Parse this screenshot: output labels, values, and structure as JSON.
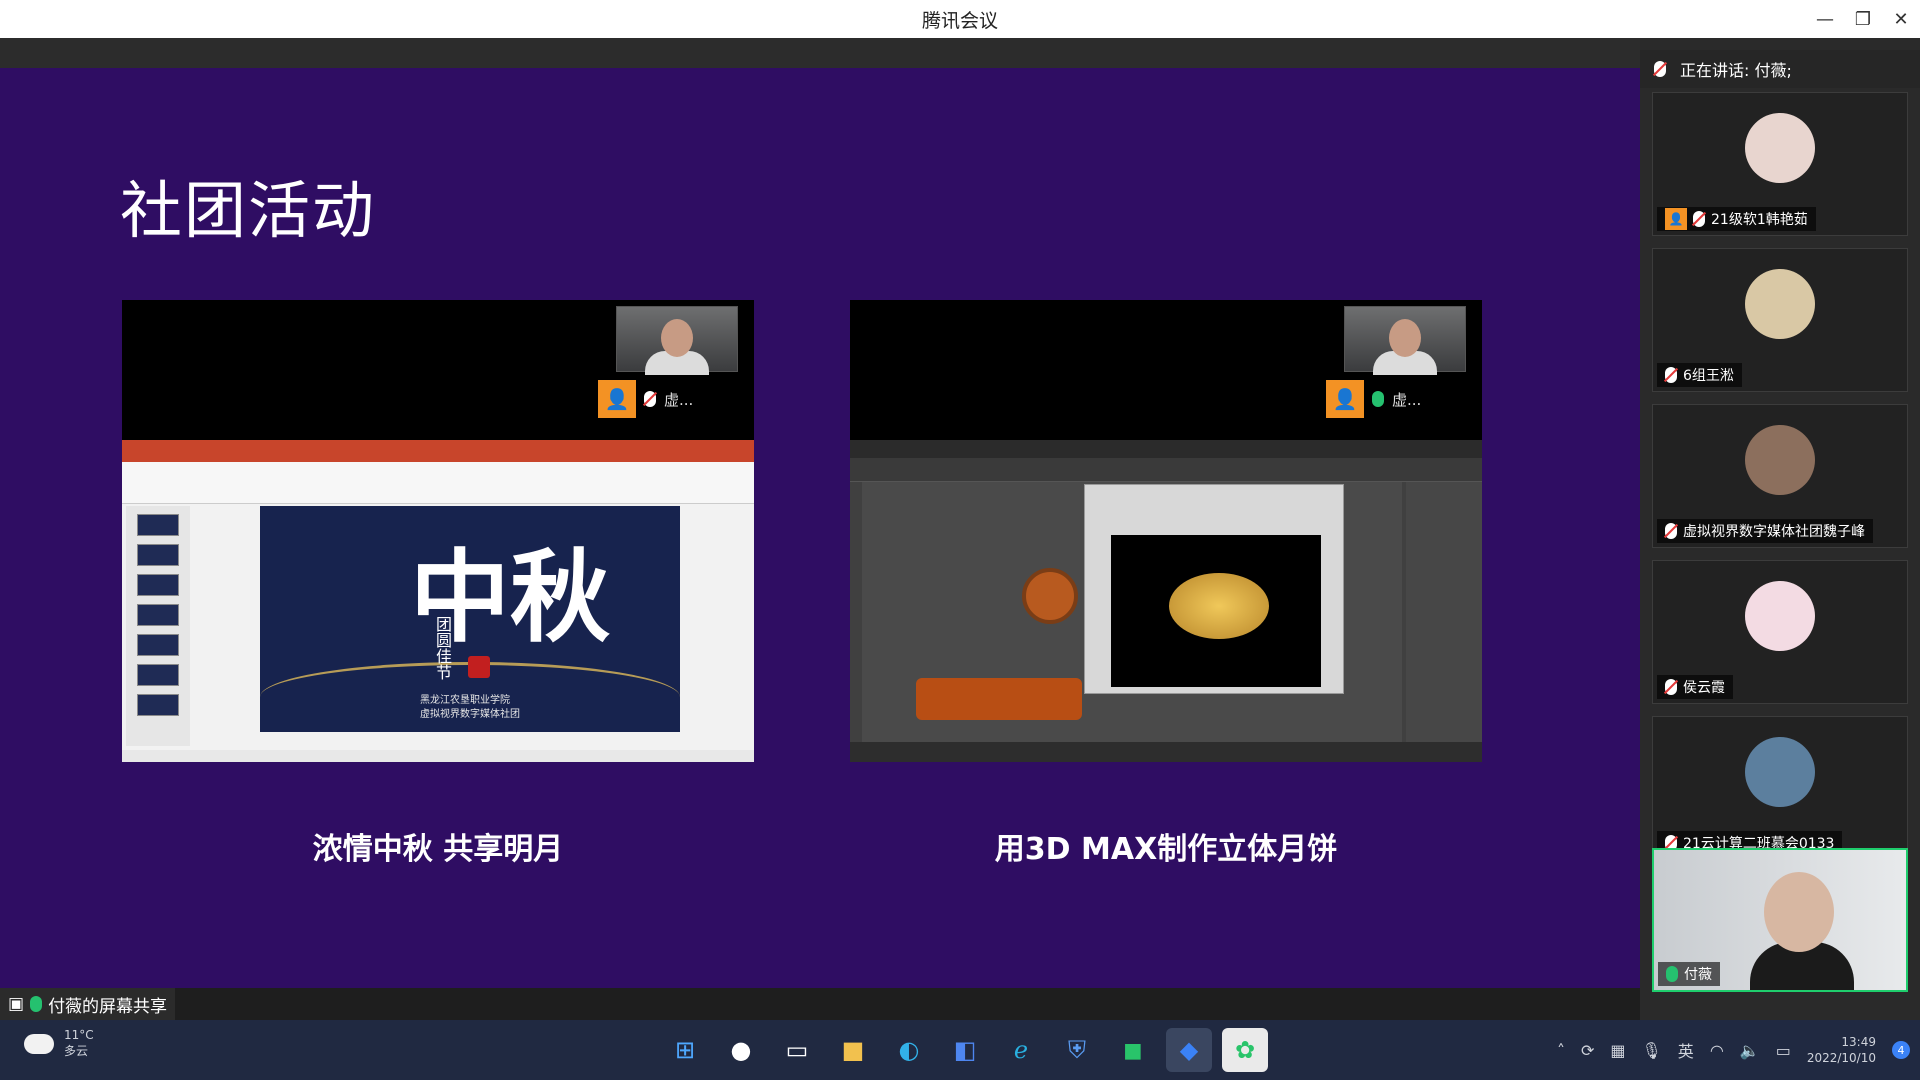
{
  "window": {
    "title": "腾讯会议",
    "minimize_icon": "minimize-icon",
    "restore_icon": "restore-icon",
    "close_icon": "close-icon"
  },
  "slide": {
    "title": "社团活动",
    "left": {
      "caption": "浓情中秋 共享明月",
      "presenter_tag": "虚...",
      "ppt_big_text": "中秋",
      "ppt_vertical_text": "团圆佳节",
      "ppt_sub_line1": "黑龙江农垦职业学院",
      "ppt_sub_line2": "虚拟视界数字媒体社团"
    },
    "right": {
      "caption": "用3D MAX制作立体月饼",
      "presenter_tag": "虚..."
    }
  },
  "share_bar": {
    "label": "付薇的屏幕共享"
  },
  "right_panel": {
    "speaking_label": "正在讲话: 付薇;",
    "participants": [
      {
        "name": "21级软1韩艳茹"
      },
      {
        "name": "6组王淞"
      },
      {
        "name": "虚拟视界数字媒体社团魏子峰"
      },
      {
        "name": "侯云霞"
      },
      {
        "name": "21云计算二班慕会0133"
      },
      {
        "name": "付薇"
      }
    ]
  },
  "taskbar": {
    "weather_temp": "11°C",
    "weather_desc": "多云",
    "ime": "英",
    "time": "13:49",
    "date": "2022/10/10",
    "notification_count": "4"
  },
  "colors": {
    "stage_bg": "#2f0d63",
    "active_border": "#1fce6d",
    "avatar_orange": "#f39224",
    "taskbar_bg": "#202941"
  }
}
